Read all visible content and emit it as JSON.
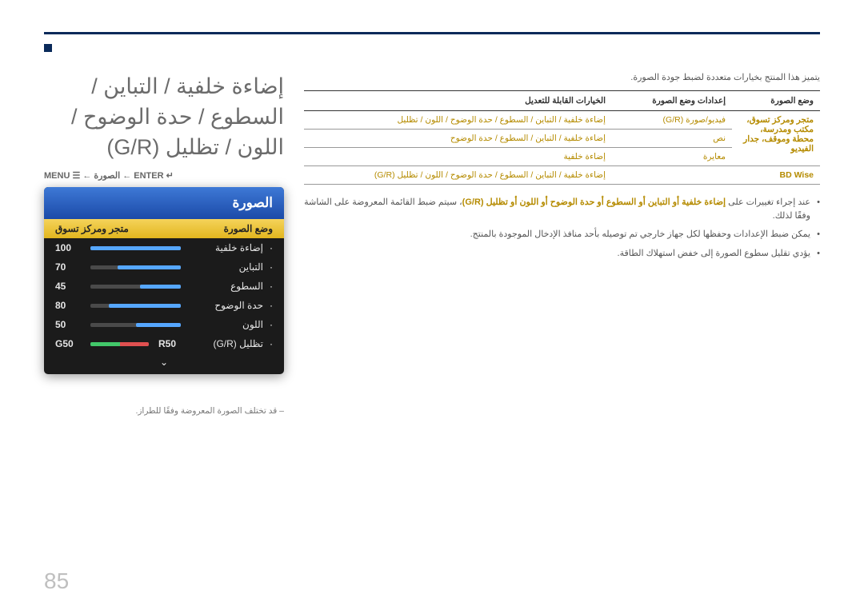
{
  "page_title": "إضاءة خلفية / التباين / السطوع / حدة الوضوح / اللون / تظليل (G/R)",
  "breadcrumb_text": "MENU ☰ ← الصورة ← ENTER ↵",
  "osd": {
    "header": "الصورة",
    "highlight_label": "وضع الصورة",
    "highlight_value": "متجر ومركز تسوق",
    "rows": [
      {
        "label": "إضاءة خلفية",
        "value": "100",
        "pct": 100
      },
      {
        "label": "التباين",
        "value": "70",
        "pct": 70
      },
      {
        "label": "السطوع",
        "value": "45",
        "pct": 45
      },
      {
        "label": "حدة الوضوح",
        "value": "80",
        "pct": 80
      },
      {
        "label": "اللون",
        "value": "50",
        "pct": 50
      }
    ],
    "tint": {
      "label": "تظليل (G/R)",
      "g": "G50",
      "r": "R50"
    },
    "arrow": "⌄"
  },
  "footnote": "– قد تختلف الصورة المعروضة وفقًا للطراز.",
  "intro": "يتميز هذا المنتج بخيارات متعددة لضبط جودة الصورة.",
  "table": {
    "headers": [
      "وضع الصورة",
      "إعدادات وضع الصورة",
      "الخيارات القابلة للتعديل"
    ],
    "rows": [
      {
        "mode": "متجر ومركز تسوق، مكتب ومدرسة، محطة وموقف، جدار الفيديو",
        "setting": "فيديو/صورة (G/R)",
        "opts": "إضاءة خلفية / التباين / السطوع / حدة الوضوح / اللون / تظليل"
      },
      {
        "mode": "",
        "setting": "نص",
        "opts": "إضاءة خلفية / التباين / السطوع / حدة الوضوح"
      },
      {
        "mode": "",
        "setting": "معايرة",
        "opts": "إضاءة خلفية"
      },
      {
        "mode": "BD Wise",
        "setting": "",
        "opts": "إضاءة خلفية / التباين / السطوع / حدة الوضوح / اللون / تظليل (G/R)"
      }
    ]
  },
  "bullets": [
    {
      "pre": "عند إجراء تغييرات على ",
      "hl": "إضاءة خلفية أو التباين أو السطوع أو حدة الوضوح أو اللون أو تظليل (G/R)",
      "post": "، سيتم ضبط القائمة المعروضة على الشاشة وفقًا لذلك."
    },
    {
      "pre": "يمكن ضبط الإعدادات وحفظها لكل جهاز خارجي تم توصيله بأحد منافذ الإدخال الموجودة بالمنتج.",
      "hl": "",
      "post": ""
    },
    {
      "pre": "يؤدي تقليل سطوع الصورة إلى خفض استهلاك الطاقة.",
      "hl": "",
      "post": ""
    }
  ],
  "page_number": "85"
}
